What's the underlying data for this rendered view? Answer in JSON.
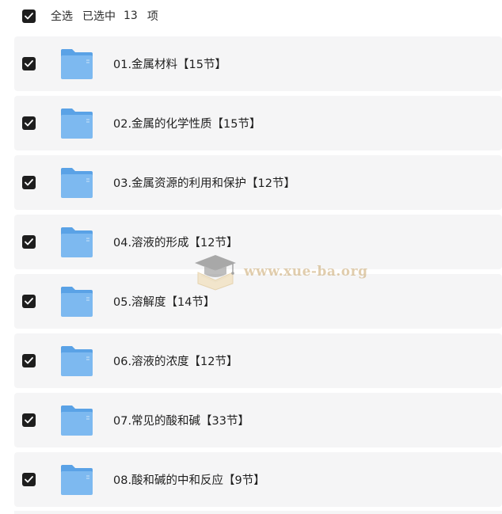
{
  "select_bar": {
    "select_all_label": "全选",
    "selected_prefix": "已选中",
    "selected_count": "13",
    "selected_suffix": "项",
    "checked": true
  },
  "items": [
    {
      "name": "01.金属材料【15节】",
      "checked": true,
      "icon": "folder-icon"
    },
    {
      "name": "02.金属的化学性质【15节】",
      "checked": true,
      "icon": "folder-icon"
    },
    {
      "name": "03.金属资源的利用和保护【12节】",
      "checked": true,
      "icon": "folder-icon"
    },
    {
      "name": "04.溶液的形成【12节】",
      "checked": true,
      "icon": "folder-icon"
    },
    {
      "name": "05.溶解度【14节】",
      "checked": true,
      "icon": "folder-icon"
    },
    {
      "name": "06.溶液的浓度【12节】",
      "checked": true,
      "icon": "folder-icon"
    },
    {
      "name": "07.常见的酸和碱【33节】",
      "checked": true,
      "icon": "folder-icon"
    },
    {
      "name": "08.酸和碱的中和反应【9节】",
      "checked": true,
      "icon": "folder-icon"
    }
  ],
  "watermark": {
    "text": "www.xue-ba.org",
    "icon": "graduation-cap-icon"
  },
  "colors": {
    "row_background": "#f5f5f6",
    "checkbox": "#1e1e1e",
    "folder_front": "#7db9f0",
    "folder_back": "#5aa2e6",
    "watermark": "#c9a66b"
  }
}
